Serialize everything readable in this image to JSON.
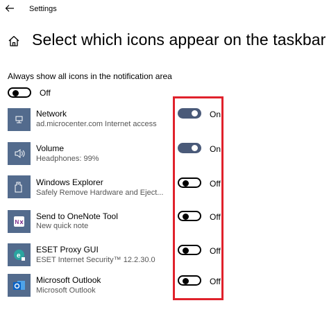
{
  "window": {
    "title": "Settings"
  },
  "page": {
    "title": "Select which icons appear on the taskbar"
  },
  "always_show": {
    "label": "Always show all icons in the notification area",
    "state": "Off"
  },
  "apps": [
    {
      "name": "Network",
      "description": "ad.microcenter.com Internet access",
      "state": "On",
      "icon": "network-icon"
    },
    {
      "name": "Volume",
      "description": "Headphones: 99%",
      "state": "On",
      "icon": "speaker-icon"
    },
    {
      "name": "Windows Explorer",
      "description": "Safely Remove Hardware and Eject...",
      "state": "Off",
      "icon": "usb-drive-icon"
    },
    {
      "name": "Send to OneNote Tool",
      "description": "New quick note",
      "state": "Off",
      "icon": "onenote-icon"
    },
    {
      "name": "ESET Proxy GUI",
      "description": "ESET Internet Security™ 12.2.30.0",
      "state": "Off",
      "icon": "eset-icon"
    },
    {
      "name": "Microsoft Outlook",
      "description": "Microsoft Outlook",
      "state": "Off",
      "icon": "outlook-icon"
    }
  ],
  "colors": {
    "toggle_on": "#4a5a79",
    "icon_tile": "#536b8d",
    "highlight_border": "#e0212b"
  }
}
